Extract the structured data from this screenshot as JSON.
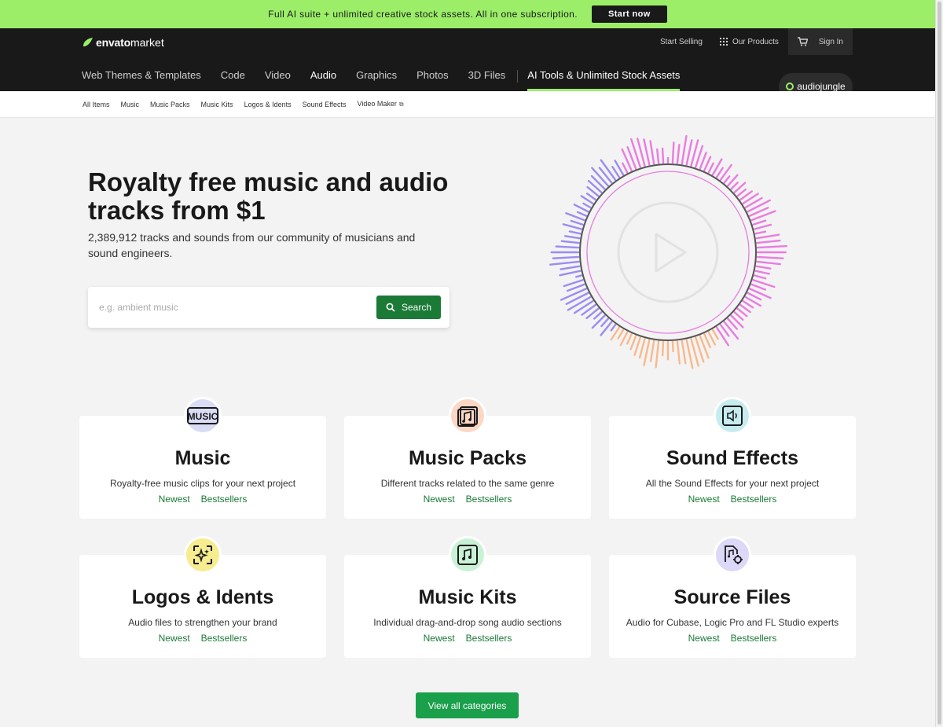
{
  "promo": {
    "text": "Full AI suite + unlimited creative stock assets. All in one subscription.",
    "button": "Start now"
  },
  "header": {
    "logo_brand": "envato",
    "logo_market": "market",
    "start_selling": "Start Selling",
    "our_products": "Our Products",
    "sign_in": "Sign In",
    "nav": [
      {
        "label": "Web Themes & Templates"
      },
      {
        "label": "Code"
      },
      {
        "label": "Video"
      },
      {
        "label": "Audio"
      },
      {
        "label": "Graphics"
      },
      {
        "label": "Photos"
      },
      {
        "label": "3D Files"
      }
    ],
    "ai_tools": "AI Tools & Unlimited Stock Assets",
    "site_badge": "audiojungle"
  },
  "subnav": [
    {
      "label": "All Items"
    },
    {
      "label": "Music"
    },
    {
      "label": "Music Packs"
    },
    {
      "label": "Music Kits"
    },
    {
      "label": "Logos & Idents"
    },
    {
      "label": "Sound Effects"
    },
    {
      "label": "Video Maker"
    }
  ],
  "hero": {
    "title": "Royalty free music and audio tracks from $1",
    "subtitle": "2,389,912 tracks and sounds from our community of musicians and sound engineers."
  },
  "search": {
    "placeholder": "e.g. ambient music",
    "value": "",
    "button": "Search"
  },
  "categories": [
    {
      "title": "Music",
      "desc": "Royalty-free music clips for your next project",
      "newest": "Newest",
      "bestsellers": "Bestsellers",
      "icon": "music-text-icon",
      "bg": "#d9dcf5"
    },
    {
      "title": "Music Packs",
      "desc": "Different tracks related to the same genre",
      "newest": "Newest",
      "bestsellers": "Bestsellers",
      "icon": "music-pack-icon",
      "bg": "#fbd7c4"
    },
    {
      "title": "Sound Effects",
      "desc": "All the Sound Effects for your next project",
      "newest": "Newest",
      "bestsellers": "Bestsellers",
      "icon": "speaker-icon",
      "bg": "#c6ecef"
    },
    {
      "title": "Logos & Idents",
      "desc": "Audio files to strengthen your brand",
      "newest": "Newest",
      "bestsellers": "Bestsellers",
      "icon": "sparkle-icon",
      "bg": "#f7ec8f"
    },
    {
      "title": "Music Kits",
      "desc": "Individual drag-and-drop song audio sections",
      "newest": "Newest",
      "bestsellers": "Bestsellers",
      "icon": "music-kit-icon",
      "bg": "#c9f1d6"
    },
    {
      "title": "Source Files",
      "desc": "Audio for Cubase, Logic Pro and FL Studio experts",
      "newest": "Newest",
      "bestsellers": "Bestsellers",
      "icon": "source-files-icon",
      "bg": "#dcd8f7"
    }
  ],
  "view_all": "View all categories",
  "colors": {
    "promo": "#9cee69",
    "header": "#191919",
    "accent_green": "#1a7a36",
    "viz_pink": "#e87de0",
    "viz_purple": "#9b8cf0",
    "viz_orange": "#f8b98c"
  }
}
